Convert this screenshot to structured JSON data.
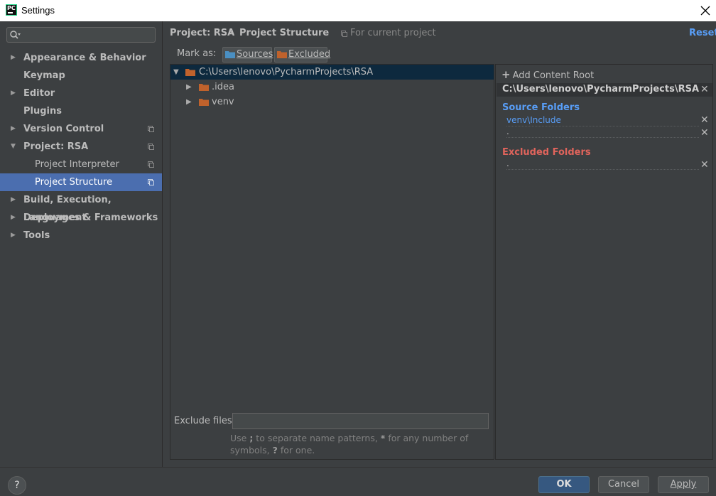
{
  "window": {
    "title": "Settings",
    "app_badge": "PC"
  },
  "sidebar": {
    "search_placeholder": "",
    "items": [
      {
        "label": "Appearance & Behavior",
        "expandable": true
      },
      {
        "label": "Keymap",
        "expandable": false
      },
      {
        "label": "Editor",
        "expandable": true
      },
      {
        "label": "Plugins",
        "expandable": false
      },
      {
        "label": "Version Control",
        "expandable": true
      },
      {
        "label": "Project: RSA",
        "expandable": true,
        "expanded": true
      },
      {
        "label": "Project Interpreter",
        "child": true
      },
      {
        "label": "Project Structure",
        "child": true,
        "selected": true
      },
      {
        "label": "Build, Execution, Deployment",
        "expandable": true
      },
      {
        "label": "Languages & Frameworks",
        "expandable": true
      },
      {
        "label": "Tools",
        "expandable": true
      }
    ]
  },
  "header": {
    "crumb_project": "Project: RSA",
    "crumb_sep": "›",
    "crumb_page": "Project Structure",
    "scope": "For current project",
    "reset": "Reset"
  },
  "mark_as": {
    "label": "Mark as:",
    "sources_btn": "Sources",
    "excluded_btn": "Excluded",
    "sources_color": "#4a8fc2",
    "excluded_color": "#c0622c"
  },
  "tree": {
    "root": "C:\\Users\\lenovo\\PycharmProjects\\RSA",
    "children": [
      ".idea",
      "venv"
    ]
  },
  "exclude": {
    "label": "Exclude files:",
    "value": "",
    "hint_parts": [
      "Use ",
      ";",
      " to separate name patterns, ",
      "*",
      " for any number of symbols, ",
      "?",
      " for one."
    ]
  },
  "content_roots": {
    "add_label": "Add Content Root",
    "root_path": "C:\\Users\\lenovo\\PycharmProjects\\RSA",
    "source_title": "Source Folders",
    "source_entries": [
      "venv\\Include",
      "."
    ],
    "excluded_title": "Excluded Folders",
    "excluded_entries": [
      "."
    ]
  },
  "footer": {
    "help": "?",
    "ok": "OK",
    "cancel": "Cancel",
    "apply": "Apply"
  },
  "colors": {
    "accent": "#4b6eaf",
    "link": "#589df6",
    "excluded_red": "#e0645c",
    "folder": "#c0622c"
  }
}
